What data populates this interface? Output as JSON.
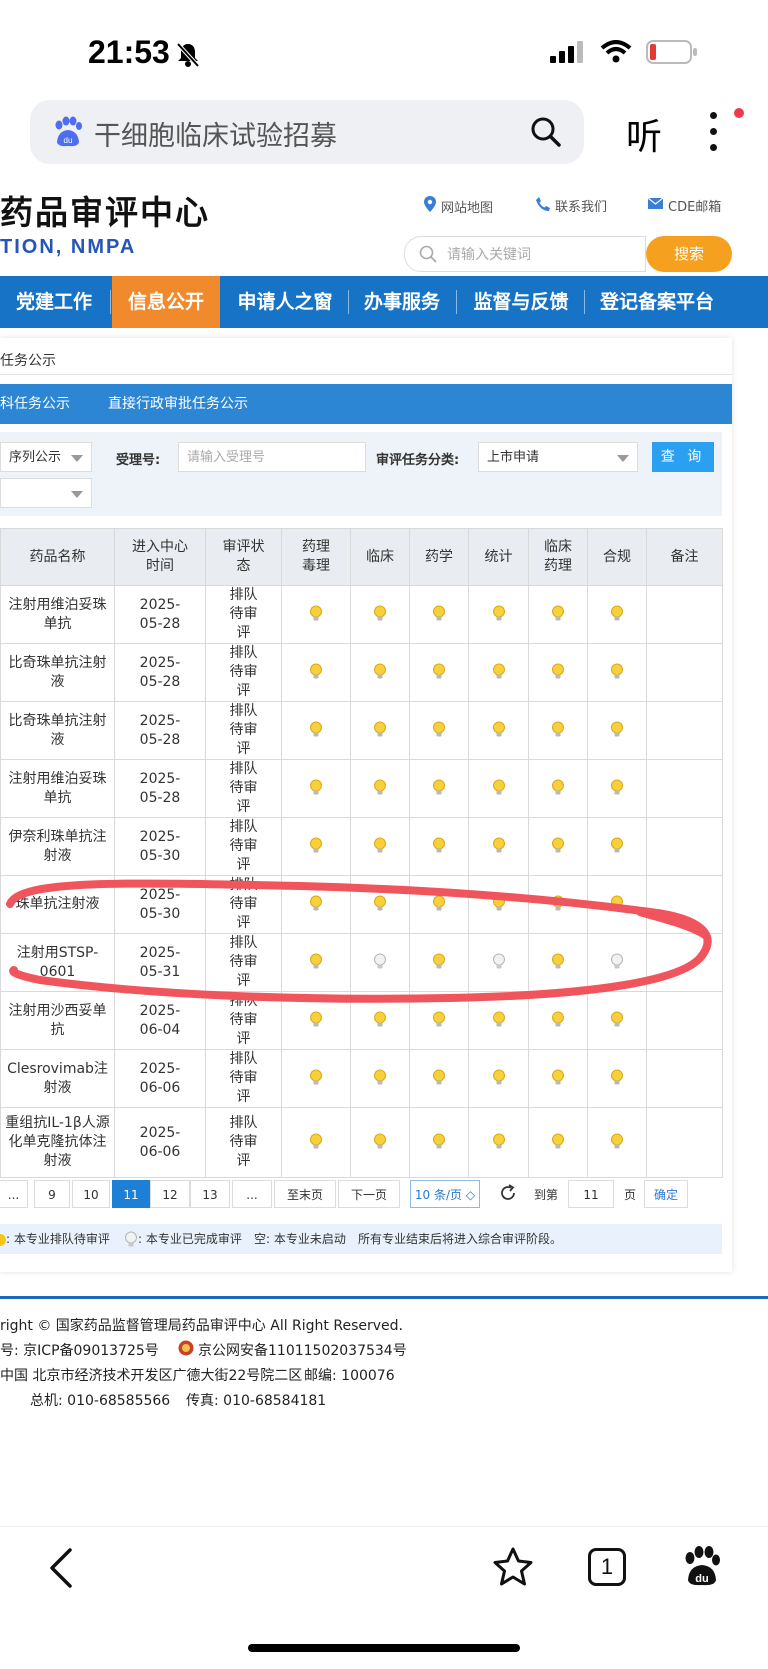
{
  "status_bar": {
    "time": "21:53"
  },
  "browser": {
    "search_text": "干细胞临床试验招募",
    "listen_label": "听"
  },
  "header": {
    "title": "药品审评中心",
    "subtitle": "TION, NMPA",
    "links": [
      "网站地图",
      "联系我们",
      "CDE邮箱"
    ],
    "search_placeholder": "请输入关键词",
    "search_button": "搜索"
  },
  "nav": {
    "items": [
      {
        "label": "党建工作"
      },
      {
        "label": "信息公开",
        "active": true
      },
      {
        "label": "申请人之窗"
      },
      {
        "label": "办事服务"
      },
      {
        "label": "监督与反馈"
      },
      {
        "label": "登记备案平台"
      }
    ]
  },
  "breadcrumb": "任务公示",
  "tabs": [
    "科任务公示",
    "直接行政审批任务公示"
  ],
  "filters": {
    "seq_select": "序列公示",
    "second_select": "",
    "accept_label": "受理号:",
    "accept_placeholder": "请输入受理号",
    "category_label": "审评任务分类:",
    "category_value": "上市申请",
    "query_button": "查 询"
  },
  "table": {
    "headers": [
      "药品名称",
      "进入中心时间",
      "审评状态",
      "药理毒理",
      "临床",
      "药学",
      "统计",
      "临床药理",
      "合规",
      "备注"
    ],
    "rows": [
      {
        "name": "注射用维泊妥珠单抗",
        "date": "2025-05-28",
        "status": "排队待审评",
        "done": [
          false,
          false,
          false,
          false,
          false,
          false
        ],
        "note": ""
      },
      {
        "name": "比奇珠单抗注射液",
        "date": "2025-05-28",
        "status": "排队待审评",
        "done": [
          false,
          false,
          false,
          false,
          false,
          false
        ],
        "note": ""
      },
      {
        "name": "比奇珠单抗注射液",
        "date": "2025-05-28",
        "status": "排队待审评",
        "done": [
          false,
          false,
          false,
          false,
          false,
          false
        ],
        "note": ""
      },
      {
        "name": "注射用维泊妥珠单抗",
        "date": "2025-05-28",
        "status": "排队待审评",
        "done": [
          false,
          false,
          false,
          false,
          false,
          false
        ],
        "note": ""
      },
      {
        "name": "伊奈利珠单抗注射液",
        "date": "2025-05-30",
        "status": "排队待审评",
        "done": [
          false,
          false,
          false,
          false,
          false,
          false
        ],
        "note": ""
      },
      {
        "name": "珠单抗注射液",
        "date": "2025-05-30",
        "status": "排队待审评",
        "done": [
          false,
          false,
          false,
          false,
          false,
          false
        ],
        "note": ""
      },
      {
        "name": "注射用STSP-0601",
        "date": "2025-05-31",
        "status": "排队待审评",
        "done": [
          false,
          true,
          false,
          true,
          false,
          true
        ],
        "note": ""
      },
      {
        "name": "注射用沙西妥单抗",
        "date": "2025-06-04",
        "status": "排队待审评",
        "done": [
          false,
          false,
          false,
          false,
          false,
          false
        ],
        "note": ""
      },
      {
        "name": "Clesrovimab注射液",
        "date": "2025-06-06",
        "status": "排队待审评",
        "done": [
          false,
          false,
          false,
          false,
          false,
          false
        ],
        "note": ""
      },
      {
        "name": "重组抗IL-1β人源化单克隆抗体注射液",
        "date": "2025-06-06",
        "status": "排队待审评",
        "done": [
          false,
          false,
          false,
          false,
          false,
          false
        ],
        "note": ""
      }
    ]
  },
  "pagination": {
    "pages": [
      "...",
      "9",
      "10",
      "11",
      "12",
      "13",
      "..."
    ],
    "current": "11",
    "last": "至末页",
    "next": "下一页",
    "per_page": "10 条/页 ◇",
    "goto_label": "到第",
    "goto_value": "11",
    "page_suffix": "页",
    "confirm": "确定"
  },
  "legend": {
    "pending": ": 本专业排队待审评",
    "done": ": 本专业已完成审评",
    "empty": "空: 本专业未启动",
    "note": "所有专业结束后将进入综合审评阶段。"
  },
  "footer": {
    "copyright": "right © 国家药品监督管理局药品审评中心    All Right Reserved.",
    "icp": "号: 京ICP备09013725号",
    "police": "京公网安备11011502037534号",
    "address": "中国 北京市经济技术开发区广德大街22号院二区",
    "postcode": "邮编: 100076",
    "phone": "总机: 010-68585566",
    "fax": "传真: 010-68584181"
  },
  "bottom_bar": {
    "tab_count": "1"
  },
  "colors": {
    "nav_blue": "#1773c6",
    "nav_active": "#f18a2c",
    "search_orange": "#f5a11f",
    "annotation_red": "#f0555e",
    "bulb_yellow": "#f5c518"
  }
}
